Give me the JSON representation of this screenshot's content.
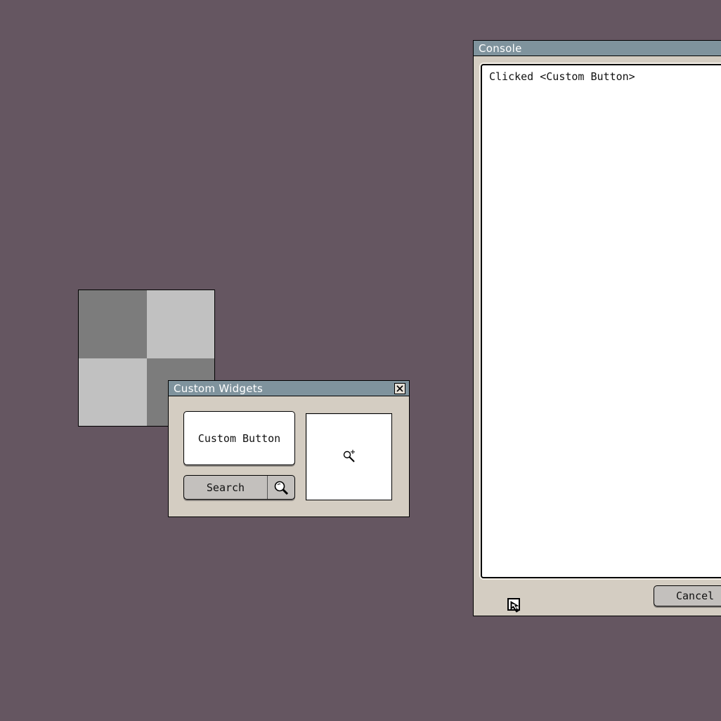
{
  "checker": {
    "colors": [
      "#7c7c7c",
      "#c1c1c1",
      "#c1c1c1",
      "#7c7c7c"
    ]
  },
  "widgets_window": {
    "title": "Custom Widgets",
    "custom_button_label": "Custom Button",
    "search_button_label": "Search"
  },
  "console_window": {
    "title": "Console",
    "log": "Clicked <Custom Button>",
    "cancel_label": "Cancel"
  },
  "colors": {
    "desktop": "#655661",
    "titlebar": "#7f939d",
    "window_bg": "#d4cdc2"
  }
}
